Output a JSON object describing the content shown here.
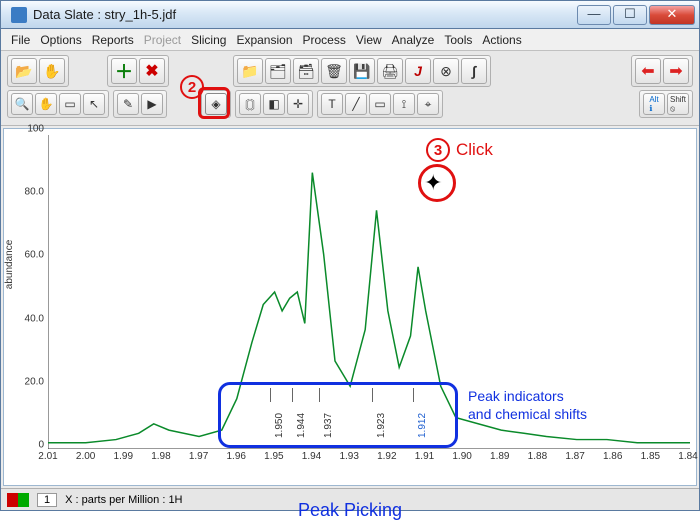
{
  "window": {
    "title": "Data Slate : stry_1h-5.jdf"
  },
  "menu": {
    "file": "File",
    "options": "Options",
    "reports": "Reports",
    "project": "Project",
    "slicing": "Slicing",
    "expansion": "Expansion",
    "process": "Process",
    "view": "View",
    "analyze": "Analyze",
    "tools": "Tools",
    "actions": "Actions"
  },
  "annotations": {
    "step2": "2",
    "step3": "3",
    "click": "Click",
    "indic_line1": "Peak indicators",
    "indic_line2": "and chemical shifts",
    "caption": "Peak Picking"
  },
  "status": {
    "index": "1",
    "xunit": "X : parts per Million : 1H"
  },
  "chart_data": {
    "type": "line",
    "xlabel": "",
    "ylabel": "abundance",
    "xlim": [
      2.01,
      1.84
    ],
    "ylim": [
      0,
      100
    ],
    "xticks": [
      2.01,
      2.0,
      1.99,
      1.98,
      1.97,
      1.96,
      1.95,
      1.94,
      1.93,
      1.92,
      1.91,
      1.9,
      1.89,
      1.88,
      1.87,
      1.86,
      1.85,
      1.84
    ],
    "yticks": [
      0,
      20.0,
      40.0,
      60.0,
      80.0,
      100.0
    ],
    "x": [
      2.01,
      2.0,
      1.992,
      1.986,
      1.982,
      1.978,
      1.97,
      1.964,
      1.96,
      1.956,
      1.953,
      1.95,
      1.948,
      1.946,
      1.944,
      1.942,
      1.94,
      1.937,
      1.934,
      1.93,
      1.926,
      1.923,
      1.92,
      1.917,
      1.914,
      1.912,
      1.91,
      1.906,
      1.902,
      1.896,
      1.89,
      1.884,
      1.878,
      1.87,
      1.862,
      1.854,
      1.846,
      1.84
    ],
    "y": [
      2,
      2,
      3,
      5,
      8,
      6,
      4,
      6,
      16,
      34,
      46,
      50,
      44,
      48,
      50,
      40,
      88,
      62,
      28,
      20,
      38,
      76,
      44,
      26,
      36,
      58,
      44,
      20,
      10,
      8,
      6,
      5,
      4,
      3,
      3,
      2,
      2,
      2
    ],
    "peaks": [
      {
        "ppm": 1.95,
        "label": "1.950"
      },
      {
        "ppm": 1.944,
        "label": "1.944"
      },
      {
        "ppm": 1.937,
        "label": "1.937"
      },
      {
        "ppm": 1.923,
        "label": "1.923"
      },
      {
        "ppm": 1.912,
        "label": "1.912",
        "selected": true
      }
    ]
  }
}
